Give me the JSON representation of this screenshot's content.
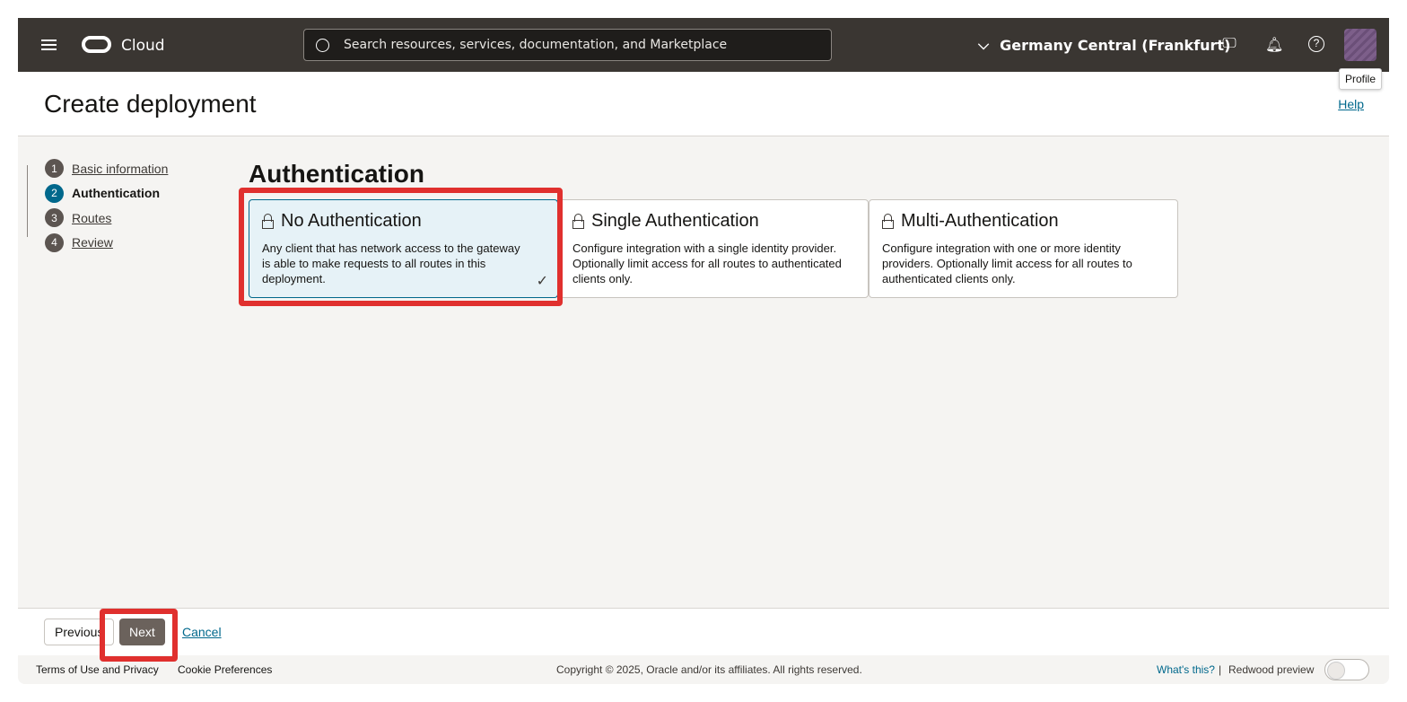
{
  "topbar": {
    "brand": "Cloud",
    "search_placeholder": "Search resources, services, documentation, and Marketplace",
    "region": "Germany Central (Frankfurt)",
    "profile_tooltip": "Profile"
  },
  "header": {
    "title": "Create deployment",
    "help": "Help"
  },
  "steps": [
    {
      "n": "1",
      "label": "Basic information"
    },
    {
      "n": "2",
      "label": "Authentication"
    },
    {
      "n": "3",
      "label": "Routes"
    },
    {
      "n": "4",
      "label": "Review"
    }
  ],
  "section_title": "Authentication",
  "options": [
    {
      "title": "No Authentication",
      "desc": "Any client that has network access to the gateway is able to make requests to all routes in this deployment.",
      "selected": true
    },
    {
      "title": "Single Authentication",
      "desc": "Configure integration with a single identity provider. Optionally limit access for all routes to authenticated clients only.",
      "selected": false
    },
    {
      "title": "Multi-Authentication",
      "desc": "Configure integration with one or more identity providers. Optionally limit access for all routes to authenticated clients only.",
      "selected": false
    }
  ],
  "actions": {
    "previous": "Previous",
    "next": "Next",
    "cancel": "Cancel"
  },
  "footer": {
    "terms": "Terms of Use and Privacy",
    "cookies": "Cookie Preferences",
    "copyright": "Copyright © 2025, Oracle and/or its affiliates. All rights reserved.",
    "whats_this": "What's this?",
    "redwood": "Redwood preview"
  },
  "colors": {
    "accent": "#00688c",
    "highlight": "#e0302e",
    "topbar": "#3a3632"
  }
}
